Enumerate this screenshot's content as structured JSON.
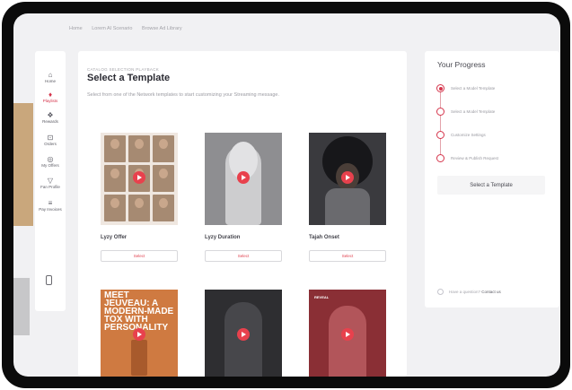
{
  "breadcrumb": [
    "Home",
    "Lorem AI Scenario",
    "Browse Ad Library"
  ],
  "sidebar": {
    "items": [
      {
        "icon": "home-icon",
        "glyph": "⌂",
        "label": "Home",
        "active": false
      },
      {
        "icon": "playlist-icon",
        "glyph": "♦",
        "label": "Playlists",
        "active": true
      },
      {
        "icon": "gift-icon",
        "glyph": "❖",
        "label": "Rewards",
        "active": false
      },
      {
        "icon": "bag-icon",
        "glyph": "⊡",
        "label": "Orders",
        "active": false
      },
      {
        "icon": "tag-icon",
        "glyph": "◎",
        "label": "My Offers",
        "active": false
      },
      {
        "icon": "profile-icon",
        "glyph": "▽",
        "label": "Fan Profile",
        "active": false
      },
      {
        "icon": "invoice-icon",
        "glyph": "≡",
        "label": "Pay Invoices",
        "active": false
      }
    ],
    "mobile_icon": "mobile-phone-icon"
  },
  "main": {
    "eyebrow": "CATALOG SELECTION PLAYBACK",
    "title": "Select a Template",
    "subtitle": "Select from one of the Network templates to start customizing your Streaming message.",
    "templates": [
      {
        "name": "Lyzy Offer",
        "button": "Select",
        "thumb_style": "grid"
      },
      {
        "name": "Lyzy Duration",
        "button": "Select",
        "thumb_style": "dur"
      },
      {
        "name": "Tajah Onset",
        "button": "Select",
        "thumb_style": "tajah"
      },
      {
        "name": "",
        "button": "",
        "thumb_style": "meet",
        "thumb_text": "MEET JEUVEAU: A MODERN-MADE TOX WITH PERSONALITY"
      },
      {
        "name": "",
        "button": "",
        "thumb_style": "dark"
      },
      {
        "name": "",
        "button": "",
        "thumb_style": "red",
        "thumb_text": "REVEAL"
      }
    ]
  },
  "progress": {
    "title": "Your Progress",
    "steps": [
      {
        "label": "Select a Model Template",
        "active": true
      },
      {
        "label": "Select a Model Template",
        "active": false
      },
      {
        "label": "Customize Settings",
        "active": false
      },
      {
        "label": "Review & Publish Request",
        "active": false
      }
    ],
    "button": "Select a Template",
    "help_text": "Have a question?",
    "help_link": "Contact us"
  },
  "colors": {
    "accent": "#d5344b",
    "play": "#e8414d",
    "bezel": "#0b0b0b",
    "canvas": "#f1f1f3"
  }
}
